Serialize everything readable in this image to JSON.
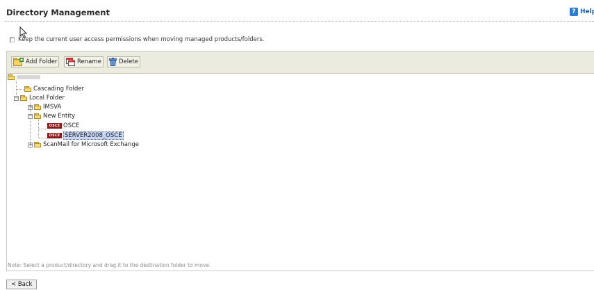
{
  "header": {
    "title": "Directory Management",
    "help_label": "Help"
  },
  "options": {
    "keep_permissions_label": "Keep the current user access permissions when moving managed products/folders.",
    "keep_permissions_checked": false
  },
  "toolbar": {
    "add_folder_label": "Add Folder",
    "rename_label": "Rename",
    "delete_label": "Delete"
  },
  "tree": {
    "root_label": "",
    "cascading_label": "Cascading Folder",
    "local_label": "Local Folder",
    "imsva_label": "IMSVA",
    "new_entity_label": "New Entity",
    "osce_label": "OSCE",
    "server_label": "SERVER2008_OSCE",
    "scanmail_label": "ScanMail for Microsoft Exchange",
    "product_badge": "OSCE"
  },
  "note": "Note: Select a product/directory and drag it to the destination folder to move.",
  "footer": {
    "back_label": "< Back"
  }
}
